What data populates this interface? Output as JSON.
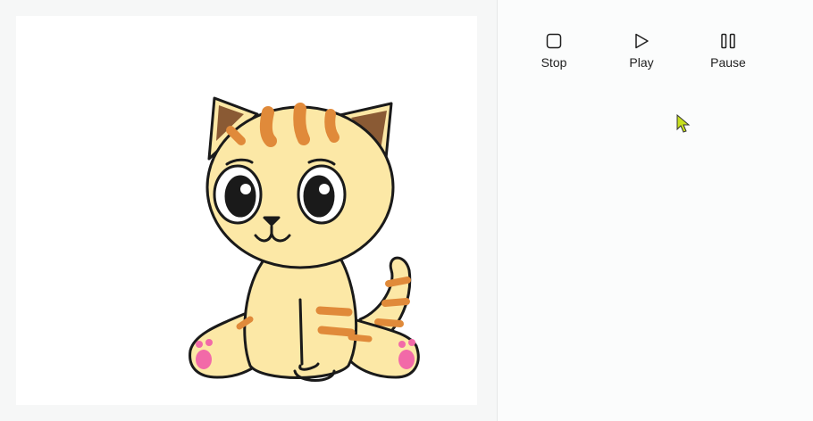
{
  "controls": {
    "stop_label": "Stop",
    "play_label": "Play",
    "pause_label": "Pause"
  },
  "icons": {
    "stop": "stop-icon",
    "play": "play-icon",
    "pause": "pause-icon"
  },
  "colors": {
    "cat_body": "#fce8a6",
    "cat_stripes": "#e08a3a",
    "paw_pads": "#f26aa8",
    "cursor": "#c8e01e"
  }
}
